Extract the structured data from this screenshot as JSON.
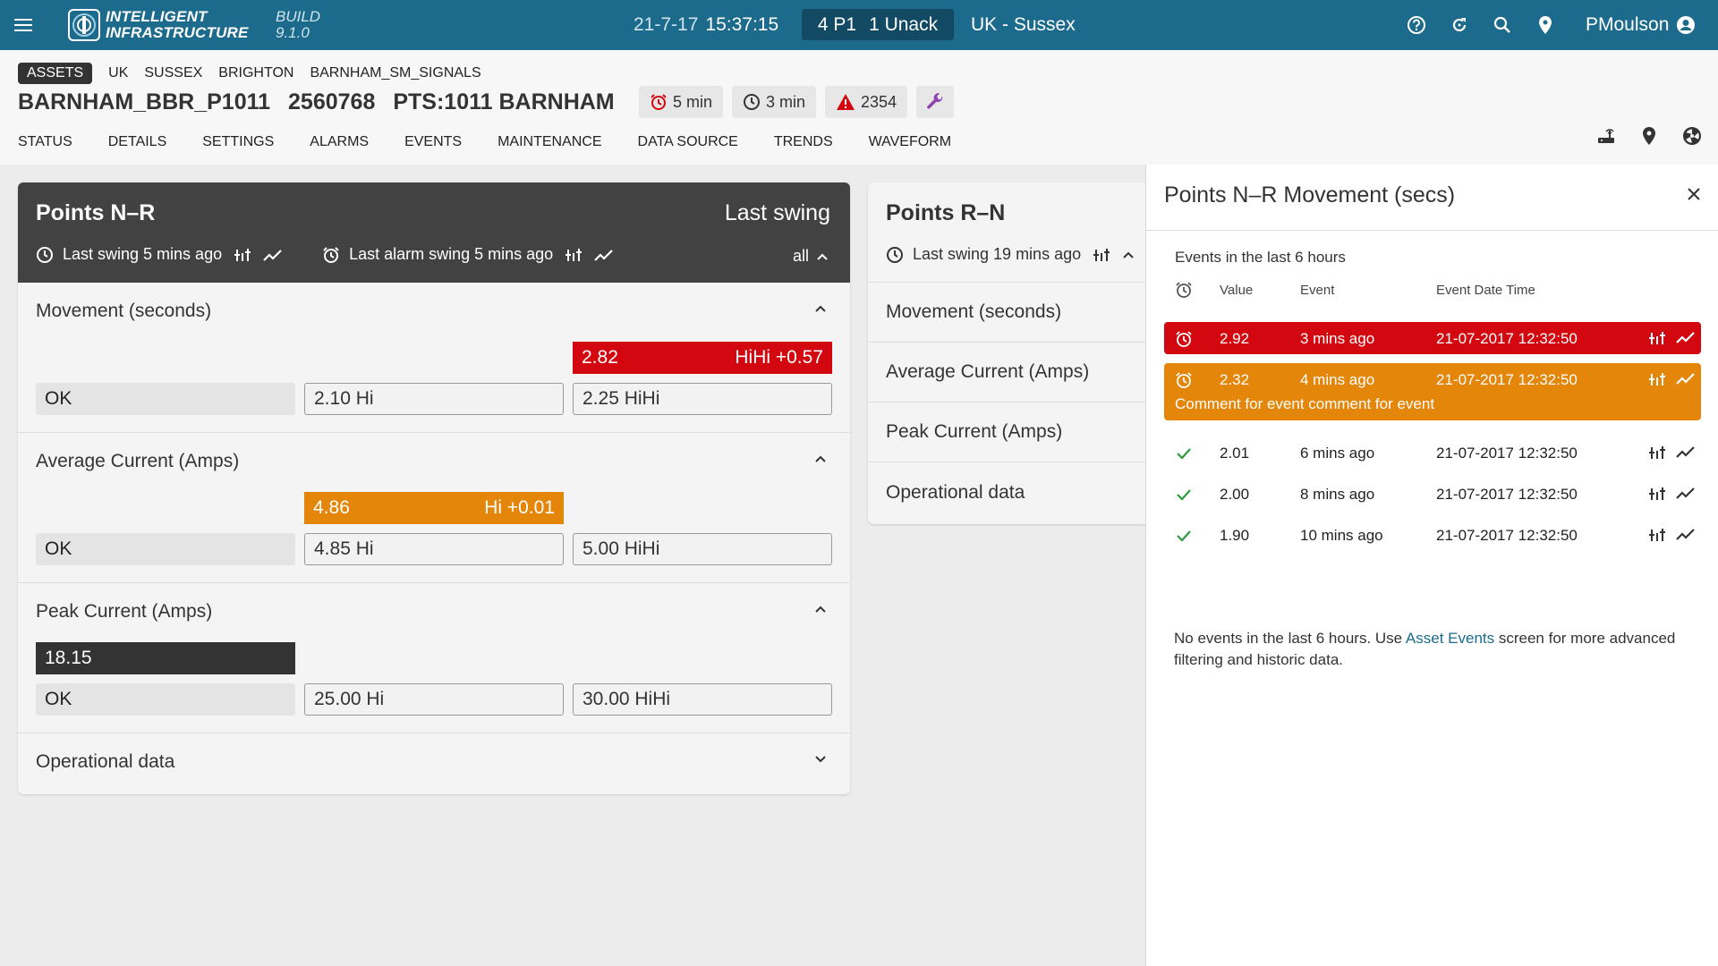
{
  "colors": {
    "topbar": "#1c6b8c",
    "alarm_red": "#d3070f",
    "alarm_orange": "#e4860a",
    "ok_green": "#2e9c3e",
    "wrench_purple": "#8e44ad",
    "link": "#1c6b8c"
  },
  "topbar": {
    "brand_line1": "INTELLIGENT",
    "brand_line2": "INFRASTRUCTURE",
    "build_line1": "BUILD",
    "build_line2": "9.1.0",
    "date": "21-7-17",
    "time": "15:37:15",
    "alarm_p1": "4 P1",
    "alarm_unack": "1 Unack",
    "region": "UK - Sussex",
    "user": "PMoulson",
    "icons": [
      "menu-icon",
      "logo-icon",
      "help-icon",
      "refresh-icon",
      "search-icon",
      "location-icon",
      "account-icon"
    ]
  },
  "header": {
    "breadcrumbs": [
      "ASSETS",
      "UK",
      "SUSSEX",
      "BRIGHTON",
      "BARNHAM_SM_SIGNALS"
    ],
    "asset_name": "BARNHAM_BBR_P1011",
    "asset_id": "2560768",
    "asset_desc": "PTS:1011 BARNHAM",
    "chip_alarm_interval": "5 min",
    "chip_interval": "3 min",
    "chip_warning_count": "2354",
    "tabs": [
      "STATUS",
      "DETAILS",
      "SETTINGS",
      "ALARMS",
      "EVENTS",
      "MAINTENANCE",
      "DATA SOURCE",
      "TRENDS",
      "WAVEFORM"
    ],
    "right_icons": [
      "router-icon",
      "location-icon",
      "radiation-icon"
    ]
  },
  "card_nr": {
    "title": "Points N–R",
    "right_title": "Last swing",
    "last_swing": "Last swing 5 mins ago",
    "last_alarm_swing": "Last alarm swing 5 mins ago",
    "filter": "all",
    "sections": [
      {
        "title": "Movement (seconds)",
        "status": "OK",
        "hi": "2.10 Hi",
        "hihi": "2.25 HiHi",
        "value": "2.82",
        "value_note": "HiHi +0.57",
        "level": "hihi"
      },
      {
        "title": "Average Current (Amps)",
        "status": "OK",
        "hi": "4.85 Hi",
        "hihi": "5.00 HiHi",
        "value": "4.86",
        "value_note": "Hi +0.01",
        "level": "hi"
      },
      {
        "title": "Peak Current (Amps)",
        "status": "OK",
        "hi": "25.00 Hi",
        "hihi": "30.00 HiHi",
        "value": "18.15",
        "value_note": "",
        "level": "ok"
      },
      {
        "title": "Operational data"
      }
    ]
  },
  "card_rn": {
    "title": "Points R–N",
    "last_swing": "Last swing 19 mins ago",
    "sections": [
      "Movement (seconds)",
      "Average Current (Amps)",
      "Peak Current (Amps)",
      "Operational data"
    ]
  },
  "panel": {
    "title": "Points N–R Movement (secs)",
    "subtitle": "Events in the last 6 hours",
    "col_value": "Value",
    "col_event": "Event",
    "col_datetime": "Event Date Time",
    "events": [
      {
        "value": "2.92",
        "event": "3 mins ago",
        "datetime": "21-07-2017 12:32:50",
        "state": "alarm_red"
      },
      {
        "value": "2.32",
        "event": "4 mins ago",
        "datetime": "21-07-2017 12:32:50",
        "state": "alarm_orange",
        "comment": "Comment for event comment for event"
      },
      {
        "value": "2.01",
        "event": "6 mins ago",
        "datetime": "21-07-2017 12:32:50",
        "state": "ok"
      },
      {
        "value": "2.00",
        "event": "8 mins ago",
        "datetime": "21-07-2017 12:32:50",
        "state": "ok"
      },
      {
        "value": "1.90",
        "event": "10 mins ago",
        "datetime": "21-07-2017 12:32:50",
        "state": "ok"
      }
    ],
    "note_before": "No events in the last 6 hours. Use ",
    "note_link": "Asset Events",
    "note_after": " screen for more advanced filtering and historic data."
  }
}
